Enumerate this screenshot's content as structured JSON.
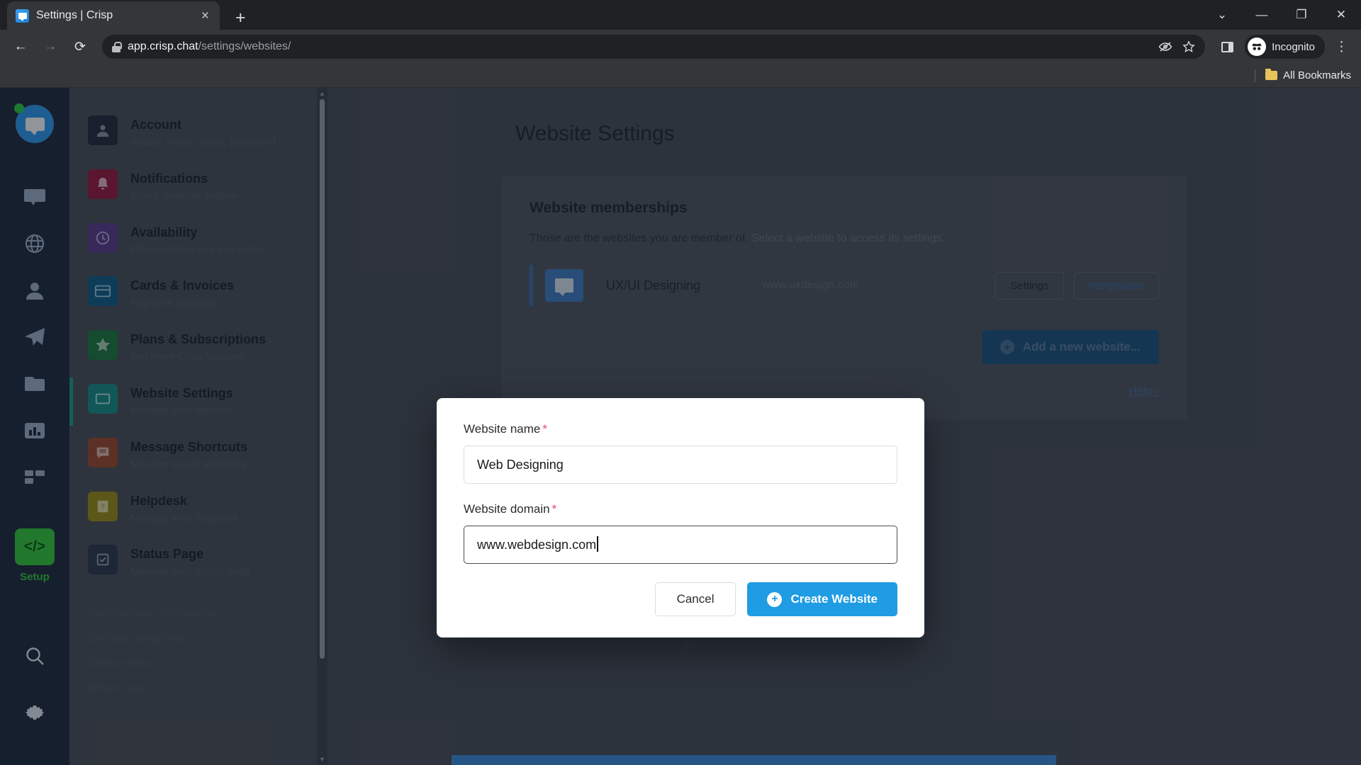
{
  "browser": {
    "tab": {
      "title": "Settings | Crisp",
      "favicon": "crisp-chat-favicon",
      "close": "×"
    },
    "newtab_label": "+",
    "window_controls": {
      "chevron": "⌄",
      "minimize": "—",
      "maximize": "❐",
      "close": "✕"
    },
    "nav": {
      "back": "←",
      "forward": "→",
      "reload": "⟳"
    },
    "omnibox": {
      "host": "app.crisp.chat",
      "path": "/settings/websites/",
      "lock_icon": "lock-icon",
      "tracking_icon": "eye-slash-icon",
      "bookmark_icon": "star-icon"
    },
    "side_panel_icon": "side-panel-icon",
    "profile": {
      "label": "Incognito",
      "icon": "incognito-icon"
    },
    "menu_icon": "kebab-menu-icon",
    "bookmarks": {
      "label": "All Bookmarks",
      "folder_icon": "folder-icon"
    }
  },
  "rail": {
    "logo": "crisp-logo",
    "status": "online",
    "icons": [
      {
        "name": "inbox-icon"
      },
      {
        "name": "globe-icon"
      },
      {
        "name": "contacts-icon"
      },
      {
        "name": "campaigns-icon"
      },
      {
        "name": "media-icon"
      },
      {
        "name": "analytics-icon"
      },
      {
        "name": "plugins-icon"
      }
    ],
    "setup": {
      "label": "Setup",
      "icon": "code-icon"
    },
    "bottom": [
      {
        "name": "search-icon"
      },
      {
        "name": "settings-gear-icon"
      }
    ]
  },
  "settings_menu": {
    "items": [
      {
        "title": "Account",
        "subtitle": "Avatar, name, email, password",
        "icon": "account-icon",
        "color": "#242c3d",
        "active": false
      },
      {
        "title": "Notifications",
        "subtitle": "Email, desktop, mobile",
        "icon": "bell-icon",
        "color": "#9c1b3c",
        "active": false
      },
      {
        "title": "Availability",
        "subtitle": "When visitors see you online",
        "icon": "clock-icon",
        "color": "#5b3f8c",
        "active": false
      },
      {
        "title": "Cards & Invoices",
        "subtitle": "Payment methods",
        "icon": "card-icon",
        "color": "#116089",
        "active": false
      },
      {
        "title": "Plans & Subscriptions",
        "subtitle": "Get more Crisp features",
        "icon": "star-icon",
        "color": "#1e7a3c",
        "active": false
      },
      {
        "title": "Website Settings",
        "subtitle": "Manage your website",
        "icon": "website-icon",
        "color": "#179187",
        "active": true
      },
      {
        "title": "Message Shortcuts",
        "subtitle": "Manage saved shortcuts",
        "icon": "shortcuts-icon",
        "color": "#9e4a2a",
        "active": false
      },
      {
        "title": "Helpdesk",
        "subtitle": "Manage your helpdesk",
        "icon": "helpdesk-icon",
        "color": "#9e8f16",
        "active": false
      },
      {
        "title": "Status Page",
        "subtitle": "Manage your status page",
        "icon": "status-icon",
        "color": "#2c3a4d",
        "active": false
      }
    ],
    "footer_links": [
      "Help translate the chatbox",
      "Get help using Crisp",
      "Service status",
      "What's new?"
    ]
  },
  "main": {
    "page_title": "Website Settings",
    "card": {
      "heading": "Website memberships",
      "description_strong": "Those are the websites you are member of.",
      "description_muted": "Select a website to access its settings.",
      "website": {
        "name": "UX/UI Designing",
        "domain": "www.uxdesign.com",
        "thumb_icon": "website-thumb-icon",
        "settings_button": "Settings",
        "integrations_button": "Integrations"
      },
      "add_button": "Add a new website...",
      "add_icon": "plus-circle-icon"
    },
    "help_link": "Help ›"
  },
  "modal": {
    "name_field": {
      "label": "Website name",
      "required": "*",
      "value": "Web Designing",
      "placeholder": ""
    },
    "domain_field": {
      "label": "Website domain",
      "required": "*",
      "value": "www.webdesign.com",
      "placeholder": "",
      "focused": true
    },
    "cancel_button": "Cancel",
    "create_button": "Create Website",
    "create_icon": "plus-circle-icon",
    "accent_color": "#1f9ce4"
  }
}
